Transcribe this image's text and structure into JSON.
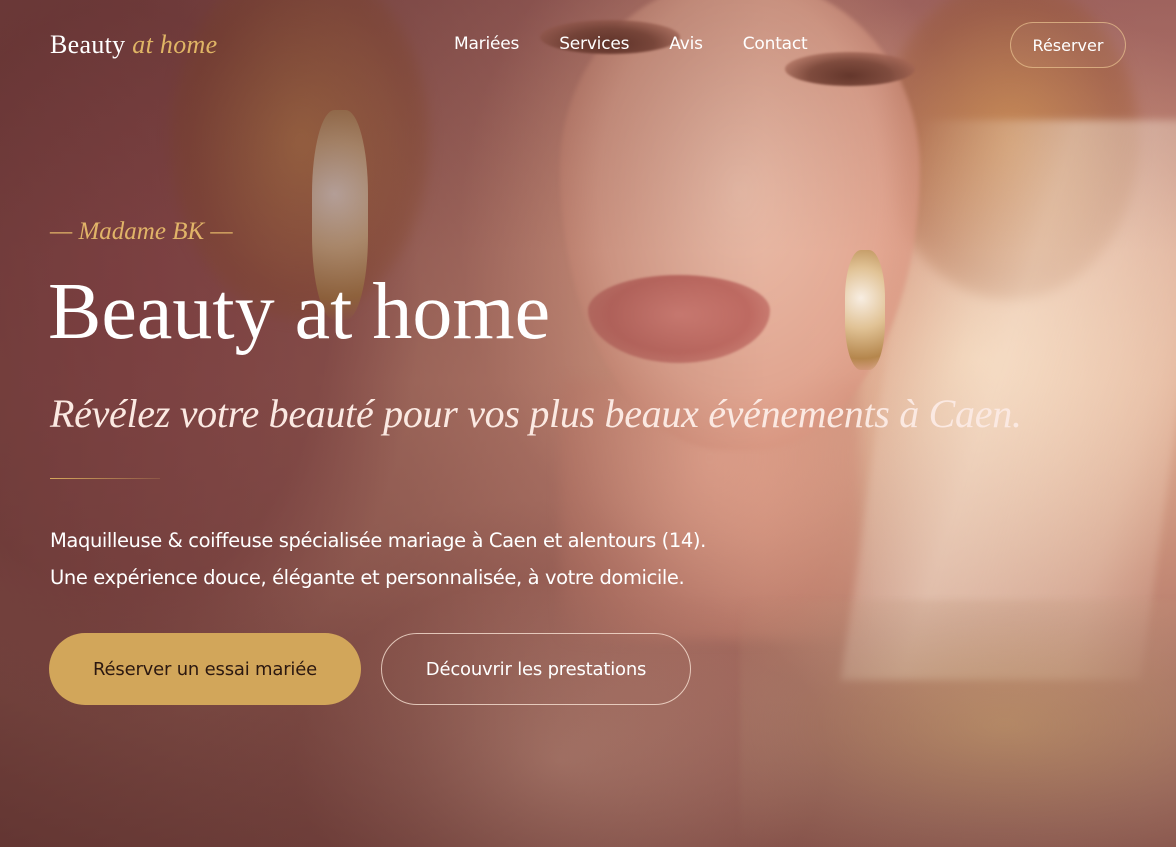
{
  "header": {
    "brand_main": "Beauty",
    "brand_accent": "at home",
    "nav": [
      {
        "label": "Mariées"
      },
      {
        "label": "Services"
      },
      {
        "label": "Avis"
      },
      {
        "label": "Contact"
      }
    ],
    "reserve_label": "Réserver"
  },
  "hero": {
    "eyebrow": "— Madame BK —",
    "title": "Beauty at home",
    "subtitle": "Révélez votre beauté pour vos plus beaux événements à Caen.",
    "description_lines": [
      "Maquilleuse & coiffeuse spécialisée mariage à Caen et alentours (14).",
      "Une expérience douce, élégante et personnalisée, à votre domicile."
    ],
    "cta_primary": "Réserver un essai mariée",
    "cta_secondary": "Découvrir les prestations"
  },
  "colors": {
    "accent_gold": "#d2a65a",
    "text_light": "#ffffff",
    "eyebrow_gold": "#e1b468"
  }
}
